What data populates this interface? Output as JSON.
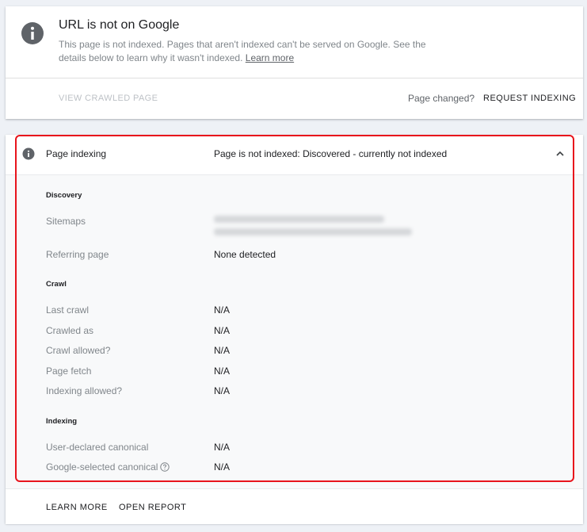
{
  "status_card": {
    "title": "URL is not on Google",
    "description": "This page is not indexed. Pages that aren't indexed can't be served on Google. See the details below to learn why it wasn't indexed.",
    "learn_more": "Learn more",
    "view_crawled_page": "VIEW CRAWLED PAGE",
    "page_changed": "Page changed?",
    "request_indexing": "REQUEST INDEXING"
  },
  "page_indexing": {
    "label": "Page indexing",
    "status": "Page is not indexed: Discovered - currently not indexed",
    "sections": {
      "discovery": {
        "title": "Discovery",
        "sitemaps_label": "Sitemaps",
        "referring_page_label": "Referring page",
        "referring_page_value": "None detected"
      },
      "crawl": {
        "title": "Crawl",
        "last_crawl_label": "Last crawl",
        "last_crawl_value": "N/A",
        "crawled_as_label": "Crawled as",
        "crawled_as_value": "N/A",
        "crawl_allowed_label": "Crawl allowed?",
        "crawl_allowed_value": "N/A",
        "page_fetch_label": "Page fetch",
        "page_fetch_value": "N/A",
        "indexing_allowed_label": "Indexing allowed?",
        "indexing_allowed_value": "N/A"
      },
      "indexing": {
        "title": "Indexing",
        "user_canonical_label": "User-declared canonical",
        "user_canonical_value": "N/A",
        "google_canonical_label": "Google-selected canonical",
        "google_canonical_value": "N/A"
      }
    },
    "footer": {
      "learn_more": "LEARN MORE",
      "open_report": "OPEN REPORT"
    }
  },
  "colors": {
    "highlight": "#e8141c",
    "info_icon": "#5f6368"
  }
}
